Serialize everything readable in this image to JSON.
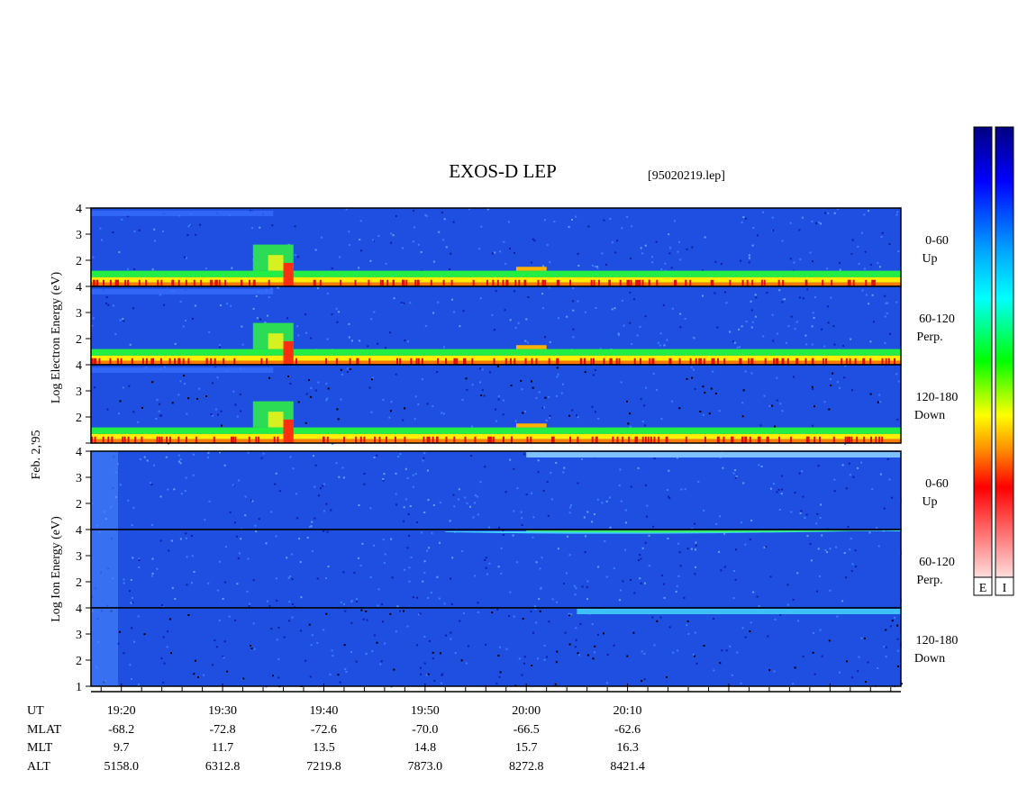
{
  "chart_data": {
    "type": "heatmap",
    "title": "EXOS-D LEP",
    "file_label": "[95020219.lep]",
    "date_label": "Feb. 2,'95",
    "electron_axis_label": "Log Electron Energy (eV)",
    "ion_axis_label": "Log Ion Energy (eV)",
    "y_ticks": [
      "4",
      "3",
      "2"
    ],
    "y_ticks_bottom": [
      "4",
      "3",
      "2",
      "1"
    ],
    "ylim": [
      1,
      4
    ],
    "xlim_minutes": [
      1157,
      1237
    ],
    "x_axis": {
      "row_labels": [
        "UT",
        "MLAT",
        "MLT",
        "ALT"
      ],
      "ticks": [
        {
          "minute": 1160,
          "ut": "19:20",
          "mlat": "-68.2",
          "mlt": "9.7",
          "alt": "5158.0"
        },
        {
          "minute": 1170,
          "ut": "19:30",
          "mlat": "-72.8",
          "mlt": "11.7",
          "alt": "6312.8"
        },
        {
          "minute": 1180,
          "ut": "19:40",
          "mlat": "-72.6",
          "mlt": "13.5",
          "alt": "7219.8"
        },
        {
          "minute": 1190,
          "ut": "19:50",
          "mlat": "-70.0",
          "mlt": "14.8",
          "alt": "7873.0"
        },
        {
          "minute": 1200,
          "ut": "20:00",
          "mlat": "-66.5",
          "mlt": "15.7",
          "alt": "8272.8"
        },
        {
          "minute": 1210,
          "ut": "20:10",
          "mlat": "-62.6",
          "mlt": "16.3",
          "alt": "8421.4"
        }
      ]
    },
    "panels": [
      {
        "species": "electron",
        "pitch": "0-60",
        "direction": "Up"
      },
      {
        "species": "electron",
        "pitch": "60-120",
        "direction": "Perp."
      },
      {
        "species": "electron",
        "pitch": "120-180",
        "direction": "Down"
      },
      {
        "species": "ion",
        "pitch": "0-60",
        "direction": "Up"
      },
      {
        "species": "ion",
        "pitch": "60-120",
        "direction": "Perp."
      },
      {
        "species": "ion",
        "pitch": "120-180",
        "direction": "Down"
      }
    ],
    "colorbars": [
      {
        "label": "E",
        "colors": [
          "#000080",
          "#0000ff",
          "#00aaff",
          "#00ffff",
          "#00ff00",
          "#ffff00",
          "#ff8800",
          "#ff0000",
          "#ffdddd"
        ]
      },
      {
        "label": "I",
        "colors": [
          "#000080",
          "#0000ff",
          "#00aaff",
          "#00ffff",
          "#00ff00",
          "#ffff00",
          "#ff8800",
          "#ff0000",
          "#ffdddd"
        ]
      }
    ]
  }
}
